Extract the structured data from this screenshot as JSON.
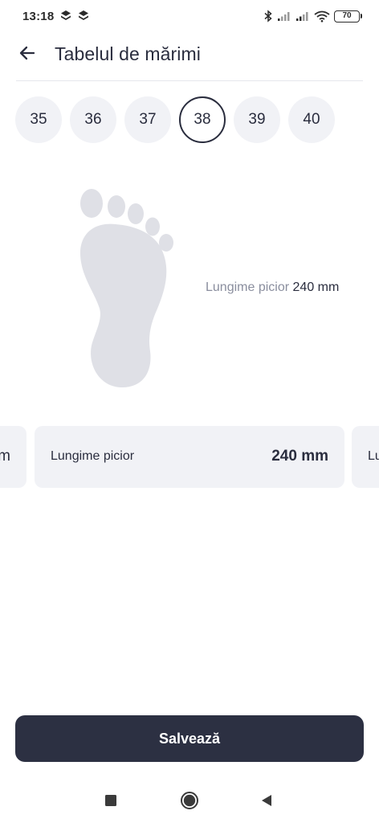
{
  "status_bar": {
    "time": "13:18",
    "battery": "70",
    "icons": [
      "app-notification-icon",
      "app-notification-icon",
      "bluetooth-icon",
      "signal-icon",
      "signal-icon",
      "wifi-icon",
      "battery-icon"
    ]
  },
  "header": {
    "back_icon": "arrow-left-icon",
    "title": "Tabelul de mărimi"
  },
  "sizes": {
    "options": [
      "35",
      "36",
      "37",
      "38",
      "39",
      "40"
    ],
    "selected": "38"
  },
  "illustration": {
    "icon": "foot-icon",
    "caption_label": "Lungime picior",
    "caption_value": "240 mm"
  },
  "cards": {
    "prev_value": "m",
    "main_label": "Lungime picior",
    "main_value": "240 mm",
    "next_label": "Lu"
  },
  "actions": {
    "save_label": "Salvează"
  },
  "nav": {
    "recents_icon": "square-icon",
    "home_icon": "circle-icon",
    "back_icon": "triangle-back-icon"
  },
  "colors": {
    "primary": "#2c3042",
    "chip_bg": "#f1f2f6",
    "foot": "#dfe0e6",
    "muted_text": "#8a8e9e"
  }
}
